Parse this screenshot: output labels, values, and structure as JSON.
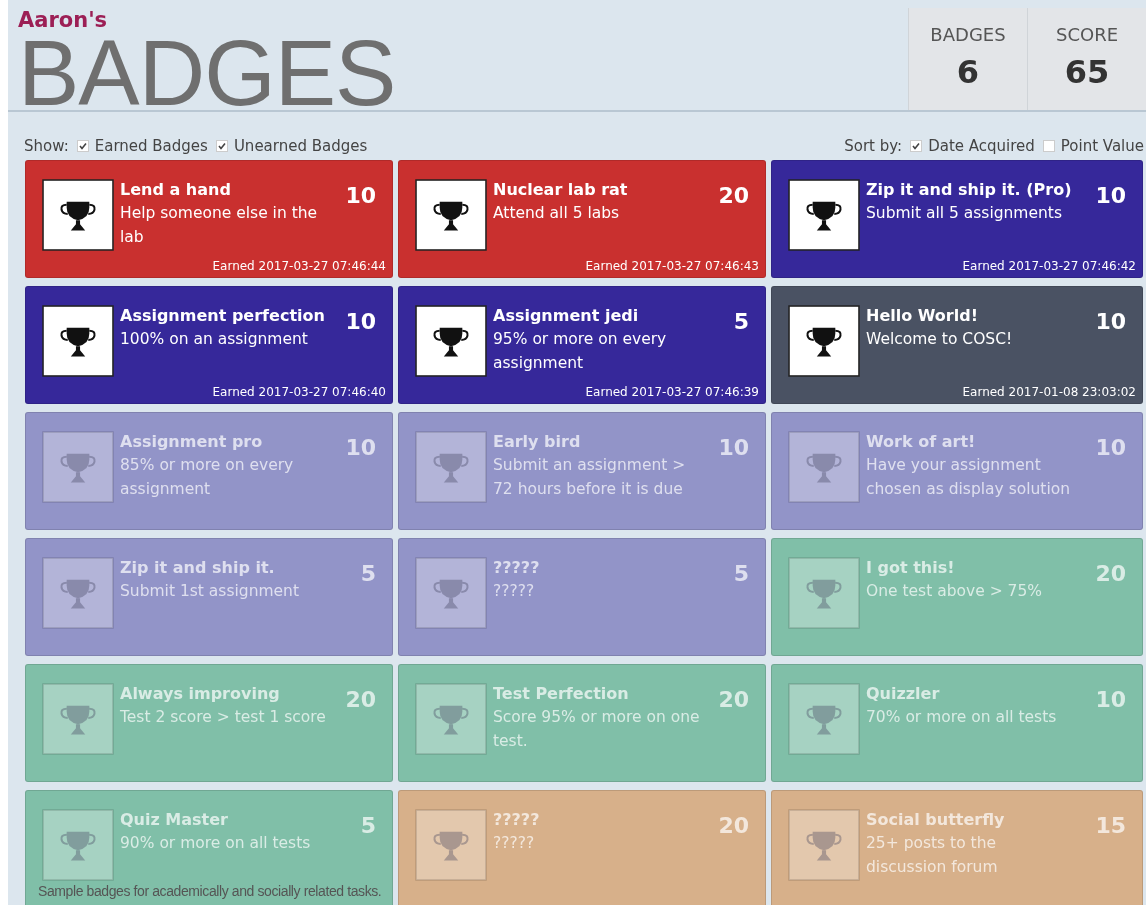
{
  "header": {
    "owner": "Aaron's",
    "title": "BADGES"
  },
  "stats": [
    {
      "label": "BADGES",
      "value": "6"
    },
    {
      "label": "SCORE",
      "value": "65"
    }
  ],
  "show": {
    "label": "Show:",
    "options": [
      {
        "label": "Earned Badges",
        "checked": true
      },
      {
        "label": "Unearned Badges",
        "checked": true
      }
    ]
  },
  "sort": {
    "label": "Sort by:",
    "options": [
      {
        "label": "Date Acquired",
        "checked": true
      },
      {
        "label": "Point Value",
        "checked": false
      }
    ]
  },
  "badges": [
    {
      "name": "Lend a hand",
      "description": "Help someone else in the lab",
      "points": "10",
      "earned": true,
      "date": "Earned 2017-03-27 07:46:44",
      "color": "#c9302f"
    },
    {
      "name": "Nuclear lab rat",
      "description": "Attend all 5 labs",
      "points": "20",
      "earned": true,
      "date": "Earned 2017-03-27 07:46:43",
      "color": "#c9302f"
    },
    {
      "name": "Zip it and ship it. (Pro)",
      "description": "Submit all 5 assignments",
      "points": "10",
      "earned": true,
      "date": "Earned 2017-03-27 07:46:42",
      "color": "#36289a"
    },
    {
      "name": "Assignment perfection",
      "description": "100% on an assignment",
      "points": "10",
      "earned": true,
      "date": "Earned 2017-03-27 07:46:40",
      "color": "#36289a"
    },
    {
      "name": "Assignment jedi",
      "description": "95% or more on every assignment",
      "points": "5",
      "earned": true,
      "date": "Earned 2017-03-27 07:46:39",
      "color": "#36289a"
    },
    {
      "name": "Hello World!",
      "description": "Welcome to COSC!",
      "points": "10",
      "earned": true,
      "date": "Earned 2017-01-08 23:03:02",
      "color": "#4a5263"
    },
    {
      "name": "Assignment pro",
      "description": "85% or more on every assignment",
      "points": "10",
      "earned": false,
      "color": "#9294c8"
    },
    {
      "name": "Early bird",
      "description": "Submit an assignment > 72 hours before it is due",
      "points": "10",
      "earned": false,
      "color": "#9294c8"
    },
    {
      "name": "Work of art!",
      "description": "Have your assignment chosen as display solution",
      "points": "10",
      "earned": false,
      "color": "#9294c8"
    },
    {
      "name": "Zip it and ship it.",
      "description": "Submit 1st assignment",
      "points": "5",
      "earned": false,
      "color": "#9294c8"
    },
    {
      "name": "?????",
      "description": "?????",
      "points": "5",
      "earned": false,
      "color": "#9294c8"
    },
    {
      "name": "I got this!",
      "description": "One test above > 75%",
      "points": "20",
      "earned": false,
      "color": "#80bfa8"
    },
    {
      "name": "Always improving",
      "description": "Test 2 score > test 1 score",
      "points": "20",
      "earned": false,
      "color": "#80bfa8"
    },
    {
      "name": "Test Perfection",
      "description": "Score 95% or more on one test.",
      "points": "20",
      "earned": false,
      "color": "#80bfa8"
    },
    {
      "name": "Quizzler",
      "description": "70% or more on all tests",
      "points": "10",
      "earned": false,
      "color": "#80bfa8"
    },
    {
      "name": "Quiz Master",
      "description": "90% or more on all tests",
      "points": "5",
      "earned": false,
      "color": "#80bfa8"
    },
    {
      "name": "?????",
      "description": "?????",
      "points": "20",
      "earned": false,
      "color": "#d7b08a"
    },
    {
      "name": "Social butterfly",
      "description": "25+ posts to the discussion forum",
      "points": "15",
      "earned": false,
      "color": "#d7b08a"
    }
  ],
  "caption": "Sample badges for academically and socially related tasks."
}
